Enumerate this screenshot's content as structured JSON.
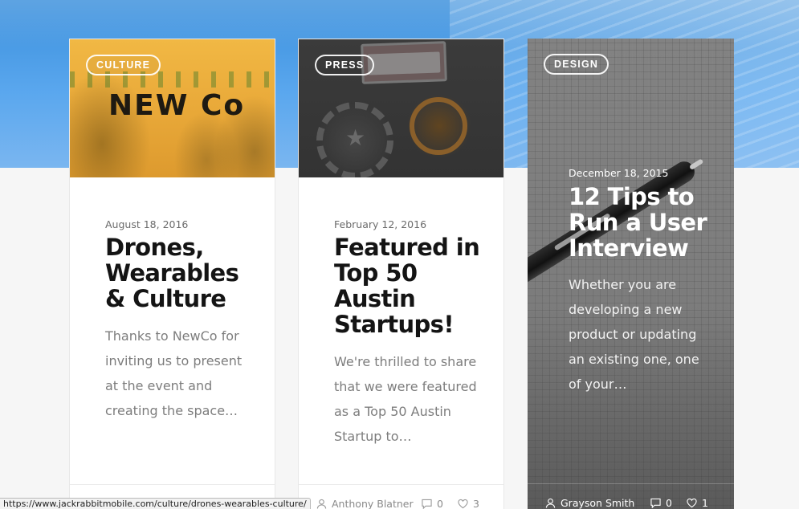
{
  "posts": [
    {
      "category": "CULTURE",
      "image_logo": "NEW Co",
      "date": "August 18, 2016",
      "title": "Drones, Wearables & Culture",
      "excerpt": "Thanks to NewCo for inviting us to present at the event and creating the space…",
      "author": "",
      "comments": "",
      "likes": ""
    },
    {
      "category": "PRESS",
      "date": "February 12, 2016",
      "title": "Featured in Top 50 Austin Startups!",
      "excerpt": "We're thrilled to share that we were featured as a Top 50 Austin Startup to…",
      "author": "Anthony Blatner",
      "comments": "0",
      "likes": "3"
    },
    {
      "category": "DESIGN",
      "date": "December 18, 2015",
      "title": "12 Tips to Run a User Interview",
      "excerpt": "Whether you are developing a new product or updating an existing one, one of your…",
      "author": "Grayson Smith",
      "comments": "0",
      "likes": "1"
    }
  ],
  "icons": {
    "author": "user-icon",
    "comments": "comment-icon",
    "likes": "heart-icon"
  },
  "status_bar": {
    "url": "https://www.jackrabbitmobile.com/culture/drones-wearables-culture/"
  },
  "colors": {
    "culture_overlay": "#f1b844",
    "press_overlay": "#3b3b3b",
    "design_overlay": "#8c8c8c",
    "hero_blue": "#4d9de6"
  }
}
